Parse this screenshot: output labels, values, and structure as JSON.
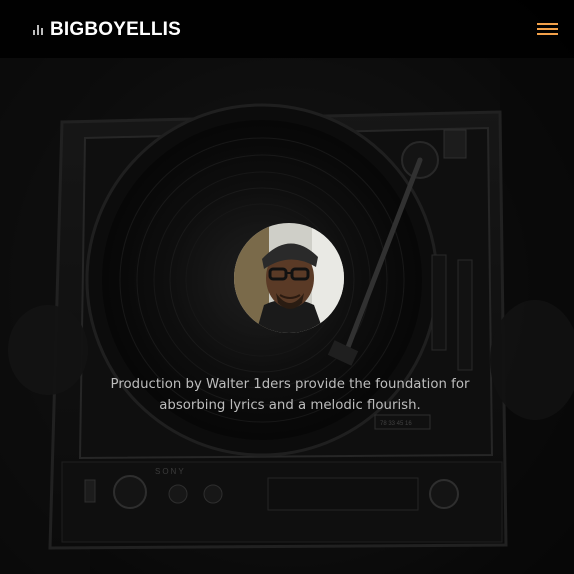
{
  "header": {
    "brand_text": "BIGBOYELLIS",
    "brand_icon": "sound-bars-icon",
    "menu_icon": "hamburger-menu-icon",
    "menu_color": "#f3a14a"
  },
  "hero": {
    "background_image": "turntable-photo",
    "avatar_image": "artist-portrait",
    "tagline": "Production by Walter 1ders provide the foundation for absorbing lyrics and a melodic flourish.",
    "turntable_labels": {
      "brand": "SONY",
      "scale": "78 33 45 16"
    }
  }
}
